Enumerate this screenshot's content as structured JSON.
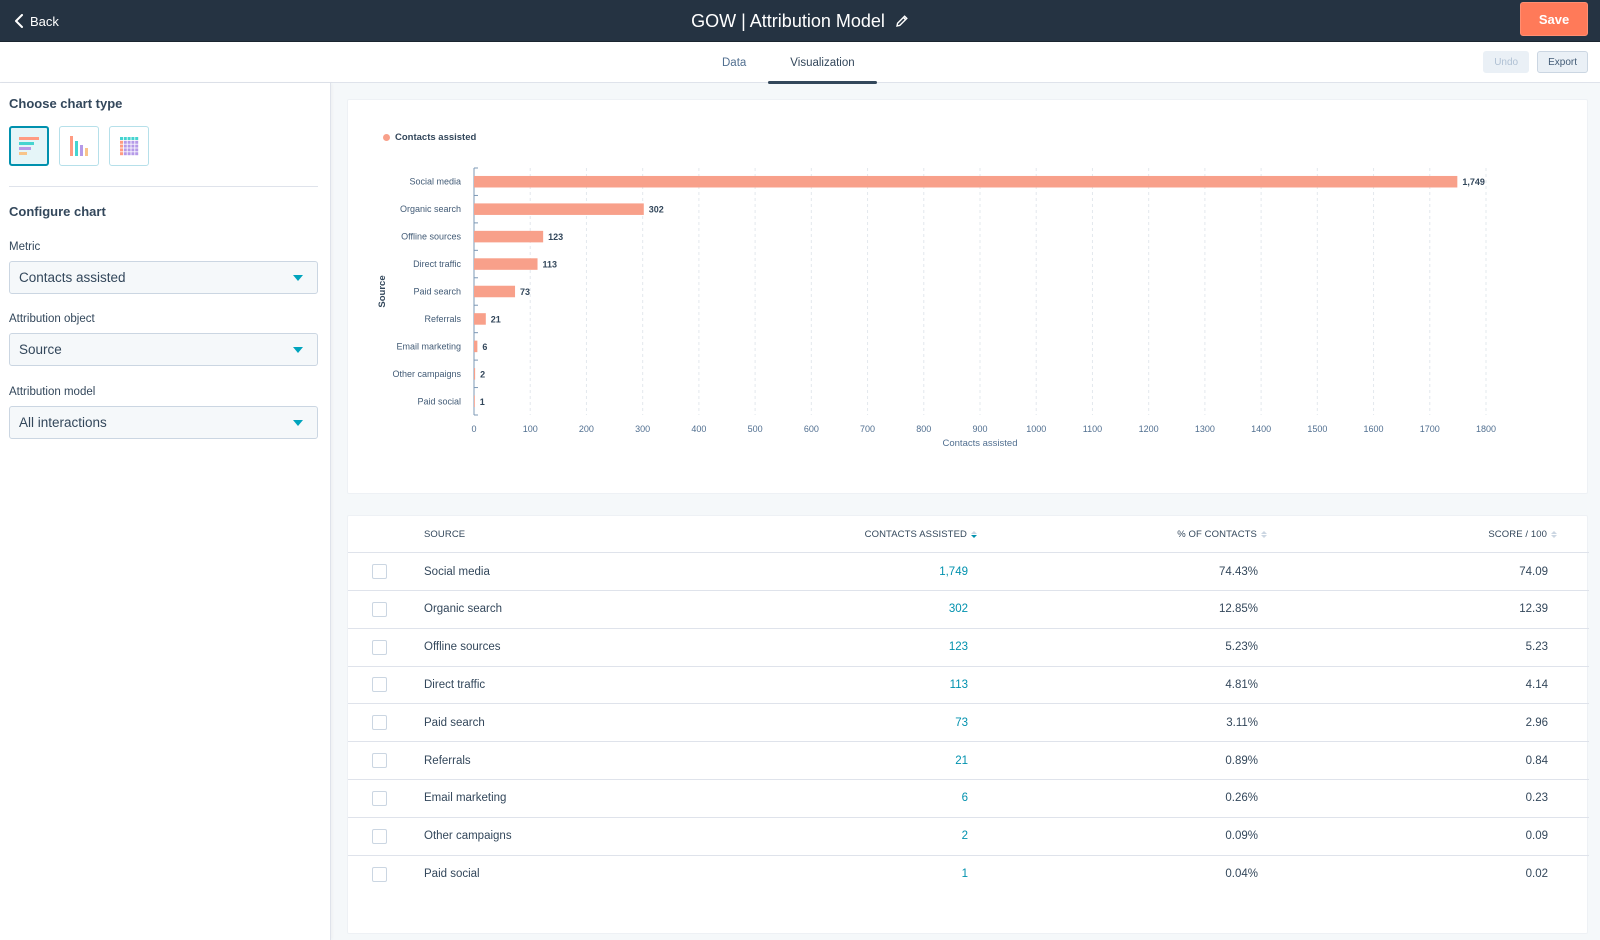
{
  "topbar": {
    "back_label": "Back",
    "title": "GOW | Attribution Model",
    "save_label": "Save"
  },
  "tabs": [
    {
      "label": "Data",
      "active": false
    },
    {
      "label": "Visualization",
      "active": true
    }
  ],
  "tab_actions": {
    "undo_label": "Undo",
    "export_label": "Export"
  },
  "sidebar": {
    "choose_chart_heading": "Choose chart type",
    "chart_types": [
      {
        "name": "horizontal-bar",
        "selected": true
      },
      {
        "name": "vertical-bar",
        "selected": false
      },
      {
        "name": "table-grid",
        "selected": false
      }
    ],
    "configure_heading": "Configure chart",
    "fields": [
      {
        "label": "Metric",
        "value": "Contacts assisted"
      },
      {
        "label": "Attribution object",
        "value": "Source"
      },
      {
        "label": "Attribution model",
        "value": "All interactions"
      }
    ]
  },
  "colors": {
    "bar": "#f8a08a",
    "accent": "#0091ae",
    "save": "#ff7a59",
    "header_bg": "#253342"
  },
  "chart_data": {
    "type": "bar",
    "orientation": "horizontal",
    "legend": [
      "Contacts assisted"
    ],
    "legend_position": "top-left",
    "categories": [
      "Social media",
      "Organic search",
      "Offline sources",
      "Direct traffic",
      "Paid search",
      "Referrals",
      "Email marketing",
      "Other campaigns",
      "Paid social"
    ],
    "values": [
      1749,
      302,
      123,
      113,
      73,
      21,
      6,
      2,
      1
    ],
    "value_labels": [
      "1,749",
      "302",
      "123",
      "113",
      "73",
      "21",
      "6",
      "2",
      "1"
    ],
    "xlabel": "Contacts assisted",
    "ylabel": "Source",
    "xlim": [
      0,
      1800
    ],
    "xticks": [
      0,
      100,
      200,
      300,
      400,
      500,
      600,
      700,
      800,
      900,
      1000,
      1100,
      1200,
      1300,
      1400,
      1500,
      1600,
      1700,
      1800
    ],
    "grid": true
  },
  "table": {
    "columns": [
      {
        "label": "SOURCE",
        "sortable": false
      },
      {
        "label": "CONTACTS ASSISTED",
        "sortable": true,
        "sorted": "desc"
      },
      {
        "label": "% OF CONTACTS",
        "sortable": true
      },
      {
        "label": "SCORE / 100",
        "sortable": true
      }
    ],
    "rows": [
      {
        "source": "Social media",
        "contacts": "1,749",
        "percent": "74.43%",
        "score": "74.09"
      },
      {
        "source": "Organic search",
        "contacts": "302",
        "percent": "12.85%",
        "score": "12.39"
      },
      {
        "source": "Offline sources",
        "contacts": "123",
        "percent": "5.23%",
        "score": "5.23"
      },
      {
        "source": "Direct traffic",
        "contacts": "113",
        "percent": "4.81%",
        "score": "4.14"
      },
      {
        "source": "Paid search",
        "contacts": "73",
        "percent": "3.11%",
        "score": "2.96"
      },
      {
        "source": "Referrals",
        "contacts": "21",
        "percent": "0.89%",
        "score": "0.84"
      },
      {
        "source": "Email marketing",
        "contacts": "6",
        "percent": "0.26%",
        "score": "0.23"
      },
      {
        "source": "Other campaigns",
        "contacts": "2",
        "percent": "0.09%",
        "score": "0.09"
      },
      {
        "source": "Paid social",
        "contacts": "1",
        "percent": "0.04%",
        "score": "0.02"
      }
    ]
  }
}
